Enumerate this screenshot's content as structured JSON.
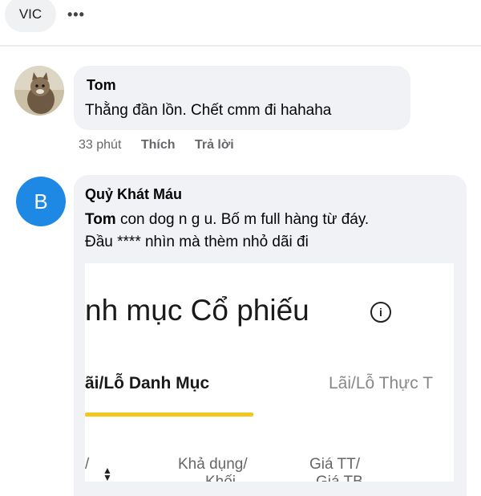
{
  "top_bar": {
    "tag_label": "VIC",
    "more_icon": "more-dots-icon"
  },
  "comments": [
    {
      "author": "Tom",
      "text": "Thằng đần lồn. Chết cmm đi hahaha",
      "time": "33 phút",
      "like_label": "Thích",
      "reply_label": "Trả lời",
      "avatar": "cat-photo"
    },
    {
      "author": "Quỷ Khát Máu",
      "avatar_letter": "B",
      "mention": "Tom",
      "text_line1": " con dog n g u. Bố m full hàng từ đáy.",
      "text_line2": "Đầu **** nhìn mà thèm nhỏ dãi đi",
      "attachment": {
        "title": "nh mục Cổ phiếu",
        "info_icon": "info-icon",
        "tab_active": "ãi/Lỗ Danh Mục",
        "tab_inactive": "Lãi/Lỗ Thực T",
        "col_slash": "/",
        "col_available": "Khả dụng/",
        "col_price": "Giá TT/",
        "col_available_cut": "Khối",
        "col_price_cut": "Giá TB"
      }
    }
  ],
  "colors": {
    "avatar_blue": "#1e88e5",
    "tab_underline": "#f3c81d",
    "bubble": "#f0f2f5"
  }
}
